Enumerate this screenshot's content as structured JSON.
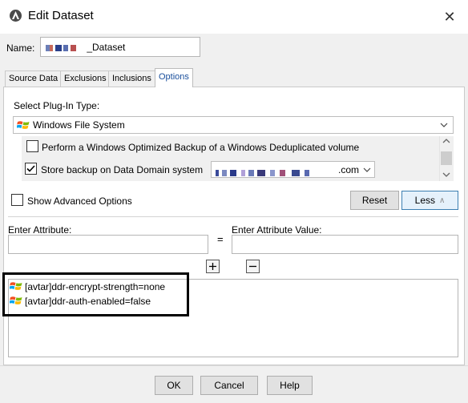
{
  "window": {
    "title": "Edit Dataset",
    "icon": "avamar-app-icon",
    "close_icon": "close-icon"
  },
  "name": {
    "label": "Name:",
    "value_suffix": "_Dataset"
  },
  "tabs": [
    {
      "label": "Source Data",
      "active": false
    },
    {
      "label": "Exclusions",
      "active": false
    },
    {
      "label": "Inclusions",
      "active": false
    },
    {
      "label": "Options",
      "active": true
    }
  ],
  "plugin": {
    "label": "Select Plug-In Type:",
    "selected": "Windows File System",
    "icon": "windows-logo-icon"
  },
  "options": {
    "windows_optimized": {
      "label": "Perform a Windows Optimized Backup of a Windows Deduplicated volume",
      "checked": false
    },
    "data_domain": {
      "label": "Store backup on Data Domain system",
      "checked": true,
      "host_suffix": ".com"
    }
  },
  "advanced": {
    "label": "Show Advanced Options",
    "checked": false,
    "reset_label": "Reset",
    "less_label": "Less"
  },
  "attribute": {
    "label": "Enter Attribute:",
    "value": "",
    "equals": "="
  },
  "attribute_value": {
    "label": "Enter Attribute Value:",
    "value": ""
  },
  "attributes_list": [
    {
      "text": "[avtar]ddr-encrypt-strength=none"
    },
    {
      "text": "[avtar]ddr-auth-enabled=false"
    }
  ],
  "footer": {
    "ok": "OK",
    "cancel": "Cancel",
    "help": "Help"
  },
  "colors": {
    "accent": "#1a4f9c",
    "highlight_border": "#000000",
    "panel_bg": "#f0f0f0"
  }
}
